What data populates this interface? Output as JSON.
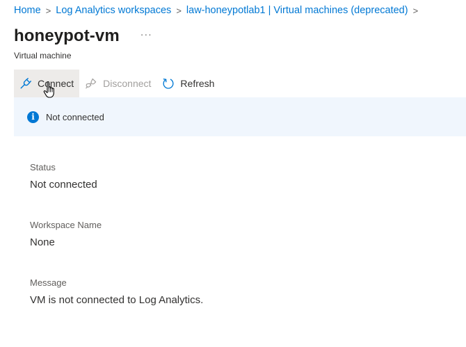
{
  "breadcrumb": {
    "items": [
      "Home",
      "Log Analytics workspaces",
      "law-honeypotlab1 | Virtual machines (deprecated)"
    ],
    "separator": ">"
  },
  "header": {
    "title": "honeypot-vm",
    "more_label": "···",
    "subtitle": "Virtual machine"
  },
  "toolbar": {
    "connect_label": "Connect",
    "disconnect_label": "Disconnect",
    "refresh_label": "Refresh"
  },
  "banner": {
    "icon": "info-icon",
    "icon_glyph": "i",
    "text": "Not connected"
  },
  "properties": [
    {
      "label": "Status",
      "value": "Not connected"
    },
    {
      "label": "Workspace Name",
      "value": "None"
    },
    {
      "label": "Message",
      "value": "VM is not connected to Log Analytics."
    }
  ],
  "colors": {
    "accent": "#0078d4",
    "banner_bg": "#f0f6fd",
    "hover_bg": "#edebe9",
    "disabled_text": "#a19f9d"
  }
}
